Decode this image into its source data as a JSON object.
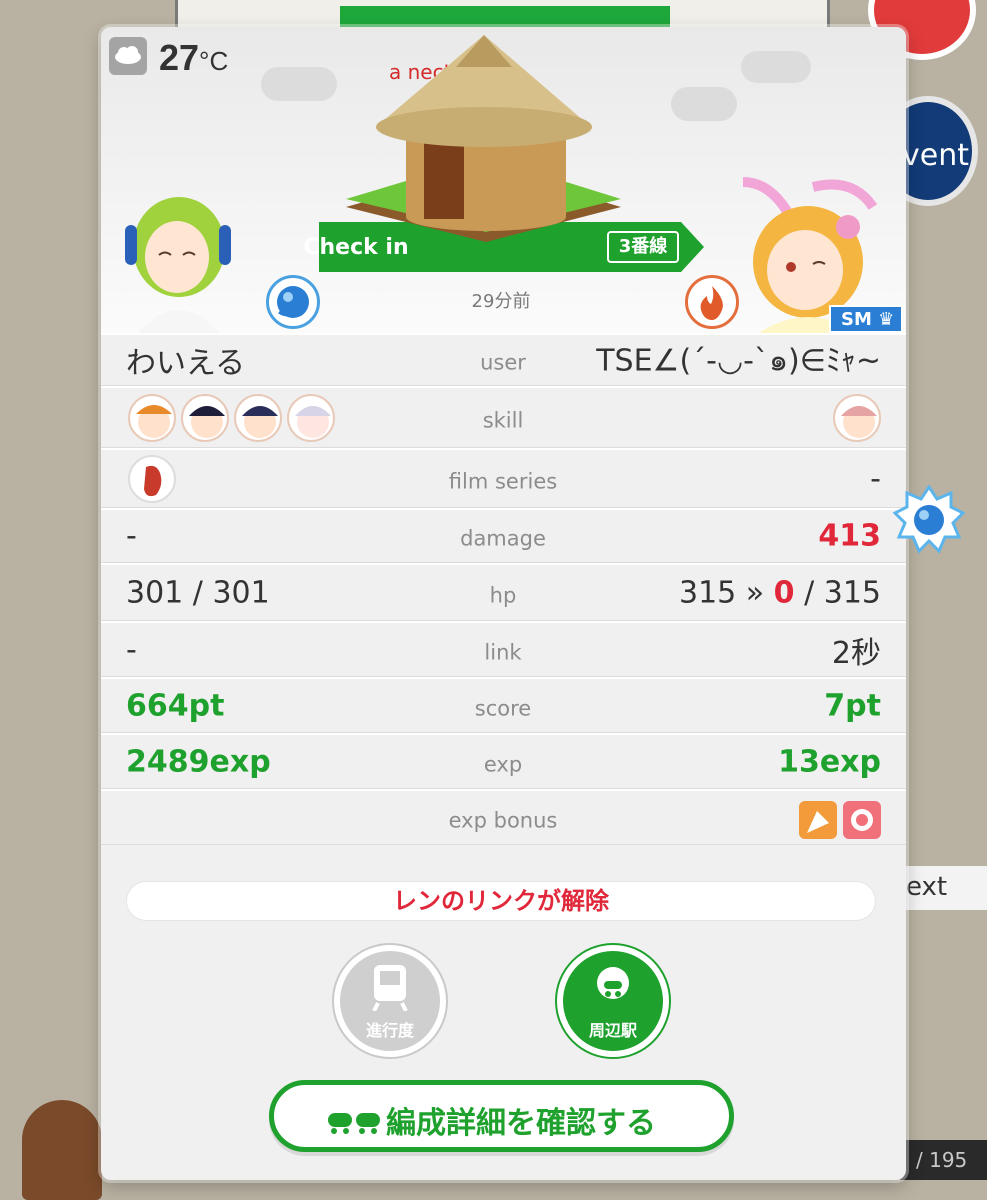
{
  "background": {
    "next_label": "ext",
    "event_label": "vent",
    "count_label": "/ 195"
  },
  "header": {
    "temperature": "27",
    "temperature_unit": "°C",
    "station_name": "a        nect",
    "checkin_label": "Check in",
    "line_label": "3番線",
    "time_ago": "29分前",
    "rank_badge": "SM"
  },
  "table": {
    "user": {
      "left": "わいえる",
      "label": "user",
      "right": "TSE∠(´-◡-`๑)∈ﾐｬ~"
    },
    "skill": {
      "label": "skill"
    },
    "film_series": {
      "left": "",
      "label": "film series",
      "right": "-"
    },
    "damage": {
      "left": "-",
      "label": "damage",
      "right": "413"
    },
    "hp": {
      "left": "301 / 301",
      "label": "hp",
      "right_before": "315 » ",
      "right_zero": "0",
      "right_after": " / 315"
    },
    "link": {
      "left": "-",
      "label": "link",
      "right": "2秒"
    },
    "score": {
      "left": "664pt",
      "label": "score",
      "right": "7pt"
    },
    "exp": {
      "left": "2489exp",
      "label": "exp",
      "right": "13exp"
    },
    "exp_bonus": {
      "label": "exp bonus"
    }
  },
  "notice": "レンのリンクが解除",
  "buttons": {
    "progress": "進行度",
    "nearby": "周辺駅",
    "formation": "編成詳細を確認する"
  },
  "colors": {
    "accent_green": "#1fa12e",
    "alert_red": "#e0283a",
    "water_blue": "#2a7fd4",
    "fire_orange": "#e46e3c"
  },
  "icons": {
    "weather": "cloud-icon",
    "attribute_left": "water-drop-icon",
    "attribute_right": "fire-icon",
    "progress": "train-icon",
    "nearby": "station-marker-icon"
  }
}
